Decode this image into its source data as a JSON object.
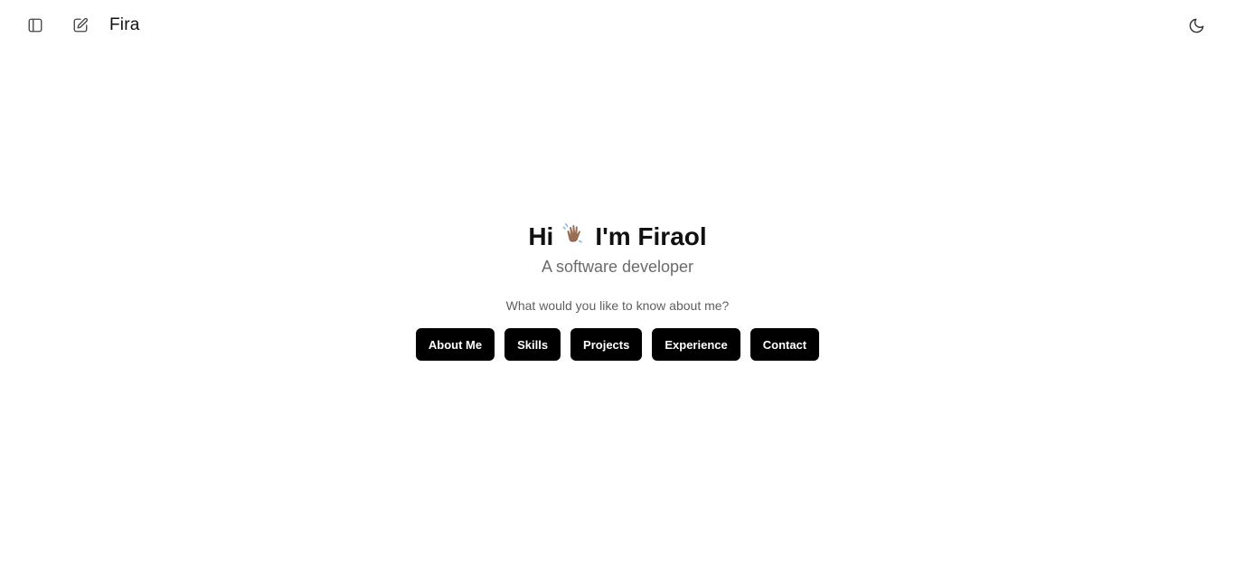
{
  "header": {
    "brand": "Fira",
    "icons": {
      "sidebar": "sidebar-panel-icon",
      "new_chat": "edit-square-icon",
      "theme": "moon-icon"
    }
  },
  "hero": {
    "greeting_prefix": "Hi",
    "greeting_emoji": "waving-hand-icon",
    "greeting_suffix": "I'm Firaol",
    "subtitle": "A software developer",
    "prompt": "What would you like to know about me?"
  },
  "actions": [
    {
      "label": "About Me"
    },
    {
      "label": "Skills"
    },
    {
      "label": "Projects"
    },
    {
      "label": "Experience"
    },
    {
      "label": "Contact"
    }
  ],
  "colors": {
    "background": "#ffffff",
    "text": "#111111",
    "muted": "#6b6b6b",
    "button_bg": "#000000",
    "button_text": "#ffffff"
  }
}
